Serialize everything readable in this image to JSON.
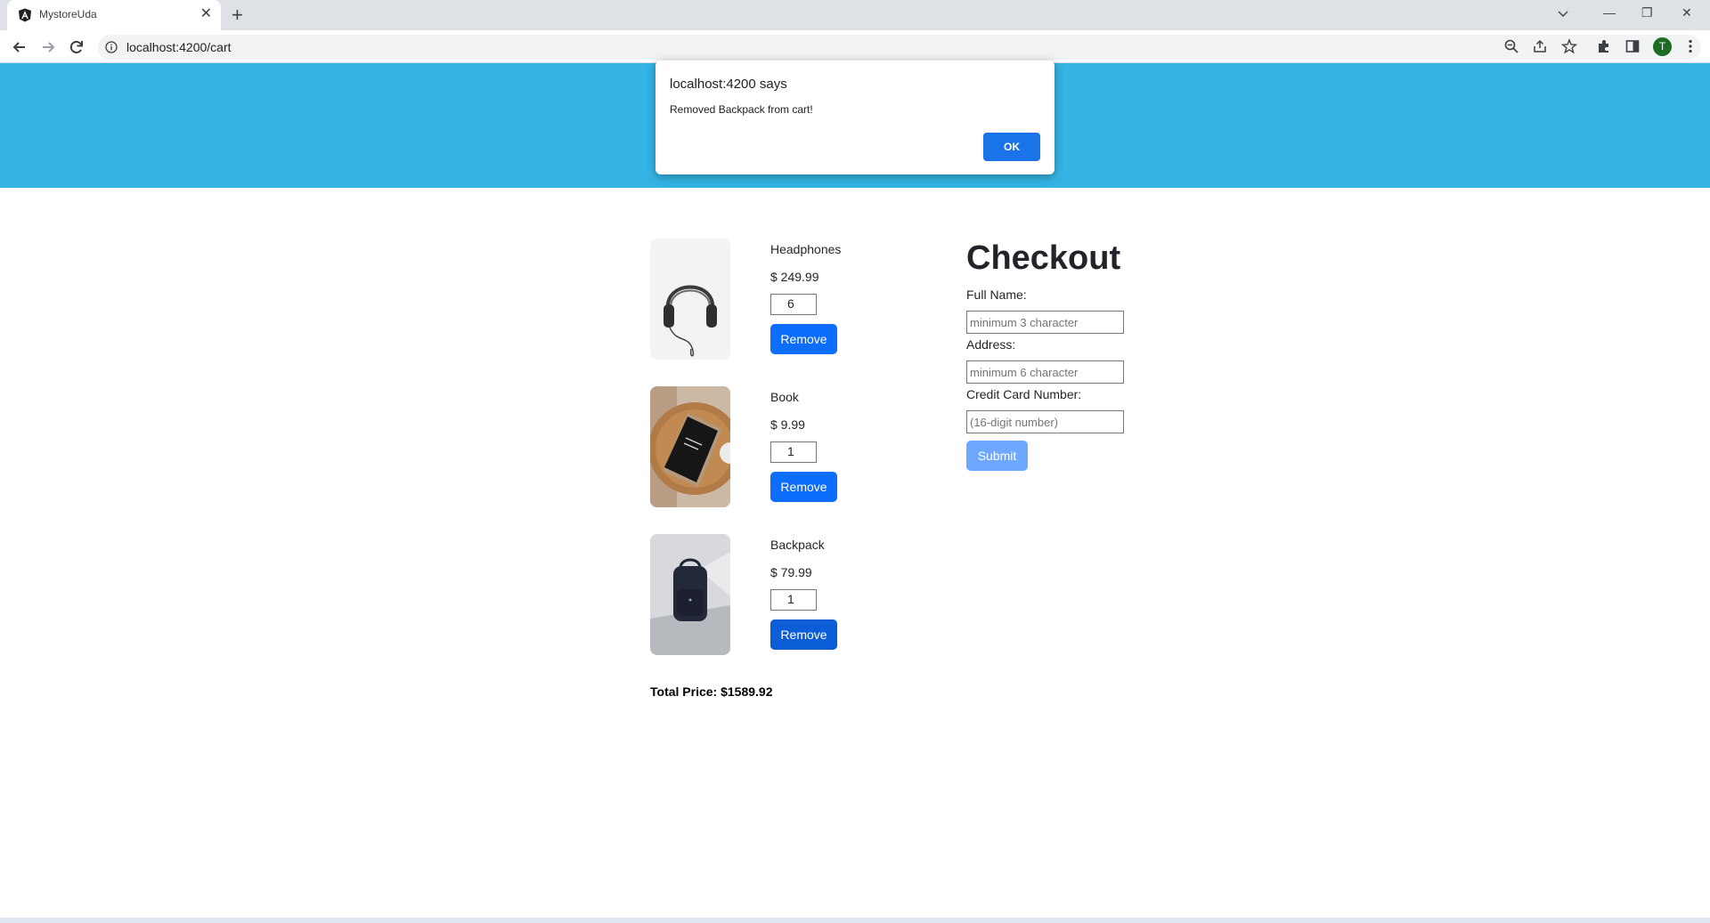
{
  "browser": {
    "tab_title": "MystoreUda",
    "url": "localhost:4200/cart",
    "avatar_initial": "T"
  },
  "cart": {
    "items": [
      {
        "name": "Headphones",
        "price": "$ 249.99",
        "quantity": "6",
        "remove_label": "Remove"
      },
      {
        "name": "Book",
        "price": "$ 9.99",
        "quantity": "1",
        "remove_label": "Remove"
      },
      {
        "name": "Backpack",
        "price": "$ 79.99",
        "quantity": "1",
        "remove_label": "Remove"
      }
    ],
    "total": "Total Price: $1589.92"
  },
  "checkout": {
    "title": "Checkout",
    "full_name_label": "Full Name:",
    "full_name_placeholder": "minimum 3 character",
    "address_label": "Address:",
    "address_placeholder": "minimum 6 character",
    "card_label": "Credit Card Number:",
    "card_placeholder": "(16-digit number)",
    "submit_label": "Submit"
  },
  "dialog": {
    "title": "localhost:4200 says",
    "message": "Removed Backpack from cart!",
    "ok_label": "OK"
  },
  "colors": {
    "header": "#34b3e4",
    "primary_button": "#0d6efd",
    "submit_disabled": "#6ea8fe",
    "dialog_ok": "#1a73e8"
  }
}
